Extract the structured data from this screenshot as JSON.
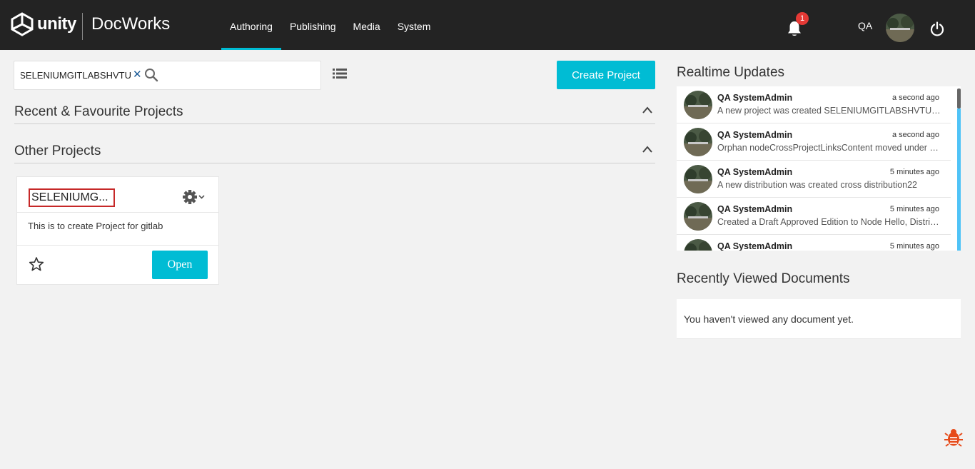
{
  "header": {
    "logo_text": "unity",
    "app_name": "DocWorks",
    "nav": [
      {
        "label": "Authoring",
        "active": true
      },
      {
        "label": "Publishing",
        "active": false
      },
      {
        "label": "Media",
        "active": false
      },
      {
        "label": "System",
        "active": false
      }
    ],
    "notification_count": "1",
    "user_initials": "QA",
    "icons": {
      "notifications": "bell-icon",
      "logout": "power-icon"
    }
  },
  "search": {
    "value": "SELENIUMGITLABSHVTU",
    "clear_icon": "close-icon",
    "search_icon": "search-icon"
  },
  "toolbar": {
    "list_view_icon": "list-view-icon",
    "create_label": "Create Project"
  },
  "sections": {
    "recent_title": "Recent & Favourite Projects",
    "other_title": "Other Projects"
  },
  "project_card": {
    "title": "SELENIUMG...",
    "description": "This is to create Project for gitlab",
    "open_label": "Open",
    "favourite": false
  },
  "realtime": {
    "title": "Realtime Updates",
    "items": [
      {
        "user": "QA SystemAdmin",
        "time": "a second ago",
        "message": "A new project was created SELENIUMGITLABSHVTU o..."
      },
      {
        "user": "QA SystemAdmin",
        "time": "a second ago",
        "message": "Orphan nodeCrossProjectLinksContent moved under U..."
      },
      {
        "user": "QA SystemAdmin",
        "time": "5 minutes ago",
        "message": "A new distribution was created cross distribution22"
      },
      {
        "user": "QA SystemAdmin",
        "time": "5 minutes ago",
        "message": "Created a Draft Approved Edition to Node Hello, Distrib..."
      },
      {
        "user": "QA SystemAdmin",
        "time": "5 minutes ago",
        "message": ""
      }
    ]
  },
  "recent_docs": {
    "title": "Recently Viewed Documents",
    "empty_text": "You haven't viewed any document yet."
  },
  "colors": {
    "accent": "#00bcd4",
    "topbar": "#232323",
    "badge": "#e53935",
    "bug": "#e64a19"
  }
}
